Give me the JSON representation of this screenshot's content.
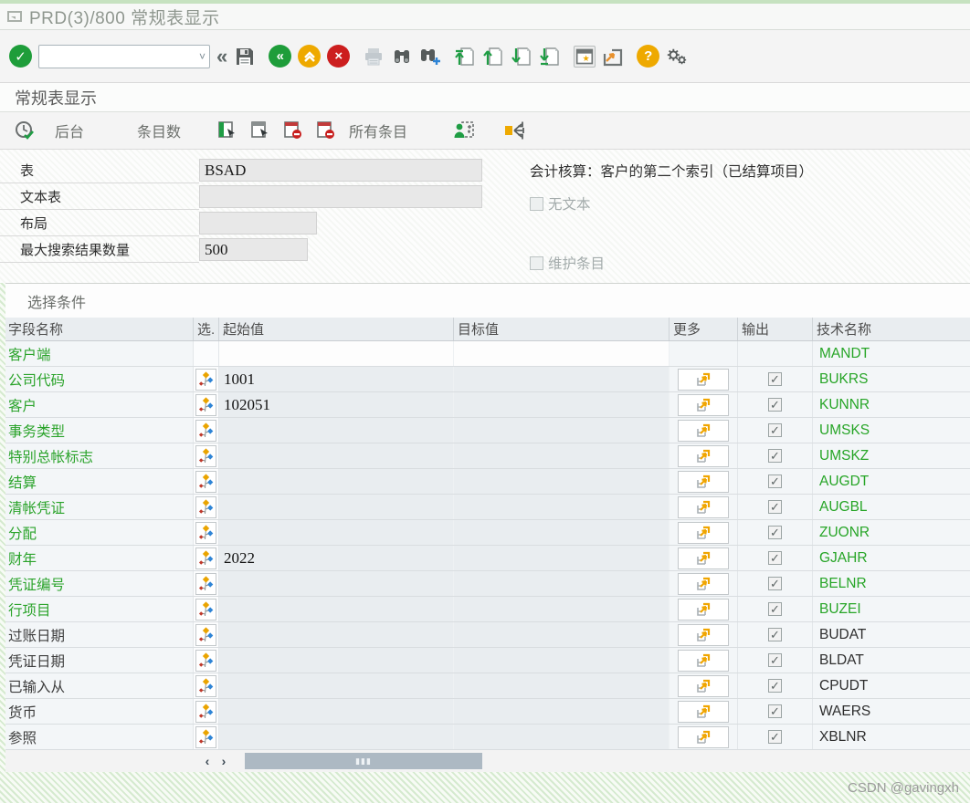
{
  "window": {
    "title": "PRD(3)/800 常规表显示"
  },
  "toolbar": {
    "command_field": {
      "value": "",
      "placeholder": ""
    },
    "icons": [
      "enter",
      "command-field",
      "collapse",
      "save",
      "back",
      "exit",
      "cancel",
      "print",
      "find",
      "find-next",
      "first-page",
      "page-up",
      "page-down",
      "last-page",
      "new-session",
      "create-shortcut",
      "help",
      "customize-layout"
    ]
  },
  "page": {
    "title": "常规表显示"
  },
  "app_toolbar": {
    "labels": {
      "background": "后台",
      "entries": "条目数",
      "all_entries": "所有条目"
    },
    "icons": [
      "execute-with-clock",
      "select-block",
      "select-all",
      "deselect-block",
      "deselect-all",
      "user-parameters",
      "distribute"
    ]
  },
  "form": {
    "fields": [
      {
        "label": "表",
        "value": "BSAD"
      },
      {
        "label": "文本表",
        "value": ""
      },
      {
        "label": "布局",
        "value": ""
      },
      {
        "label": "最大搜索结果数量",
        "value": "500"
      }
    ],
    "info_text": "会计核算：客户的第二个索引（已结算项目）",
    "checkboxes": [
      {
        "label": "无文本",
        "checked": false
      },
      {
        "label": "维护条目",
        "checked": false
      }
    ]
  },
  "selection": {
    "group_title": "选择条件",
    "columns": [
      "字段名称",
      "选.",
      "起始值",
      "目标值",
      "更多",
      "输出",
      "技术名称"
    ],
    "rows": [
      {
        "name": "客户端",
        "key": true,
        "select_icon": false,
        "start": "",
        "target": "",
        "more": false,
        "output": false,
        "tech": "MANDT"
      },
      {
        "name": "公司代码",
        "key": true,
        "select_icon": true,
        "start": "1001",
        "target": "",
        "more": true,
        "output": true,
        "tech": "BUKRS"
      },
      {
        "name": "客户",
        "key": true,
        "select_icon": true,
        "start": "102051",
        "target": "",
        "more": true,
        "output": true,
        "tech": "KUNNR"
      },
      {
        "name": "事务类型",
        "key": true,
        "select_icon": true,
        "start": "",
        "target": "",
        "more": true,
        "output": true,
        "tech": "UMSKS"
      },
      {
        "name": "特别总帐标志",
        "key": true,
        "select_icon": true,
        "start": "",
        "target": "",
        "more": true,
        "output": true,
        "tech": "UMSKZ"
      },
      {
        "name": "结算",
        "key": true,
        "select_icon": true,
        "start": "",
        "target": "",
        "more": true,
        "output": true,
        "tech": "AUGDT"
      },
      {
        "name": "清帐凭证",
        "key": true,
        "select_icon": true,
        "start": "",
        "target": "",
        "more": true,
        "output": true,
        "tech": "AUGBL"
      },
      {
        "name": "分配",
        "key": true,
        "select_icon": true,
        "start": "",
        "target": "",
        "more": true,
        "output": true,
        "tech": "ZUONR"
      },
      {
        "name": "财年",
        "key": true,
        "select_icon": true,
        "start": "2022",
        "target": "",
        "more": true,
        "output": true,
        "tech": "GJAHR"
      },
      {
        "name": "凭证编号",
        "key": true,
        "select_icon": true,
        "start": "",
        "target": "",
        "more": true,
        "output": true,
        "tech": "BELNR"
      },
      {
        "name": "行项目",
        "key": true,
        "select_icon": true,
        "start": "",
        "target": "",
        "more": true,
        "output": true,
        "tech": "BUZEI"
      },
      {
        "name": "过账日期",
        "key": false,
        "select_icon": true,
        "start": "",
        "target": "",
        "more": true,
        "output": true,
        "tech": "BUDAT"
      },
      {
        "name": "凭证日期",
        "key": false,
        "select_icon": true,
        "start": "",
        "target": "",
        "more": true,
        "output": true,
        "tech": "BLDAT"
      },
      {
        "name": "已输入从",
        "key": false,
        "select_icon": true,
        "start": "",
        "target": "",
        "more": true,
        "output": true,
        "tech": "CPUDT"
      },
      {
        "name": "货币",
        "key": false,
        "select_icon": true,
        "start": "",
        "target": "",
        "more": true,
        "output": true,
        "tech": "WAERS"
      },
      {
        "name": "参照",
        "key": false,
        "select_icon": true,
        "start": "",
        "target": "",
        "more": true,
        "output": true,
        "tech": "XBLNR"
      }
    ]
  },
  "watermark": "CSDN @gavingxh",
  "colors": {
    "accent_green": "#1e9d3a",
    "key_green": "#2aa32a",
    "warn_orange": "#eea900",
    "error_red": "#cc1e1e",
    "hatch_green": "#d5eacf",
    "header_bg": "#e9edf0",
    "input_cell": "#e9edf0",
    "disabled_gray": "#a3abab"
  }
}
